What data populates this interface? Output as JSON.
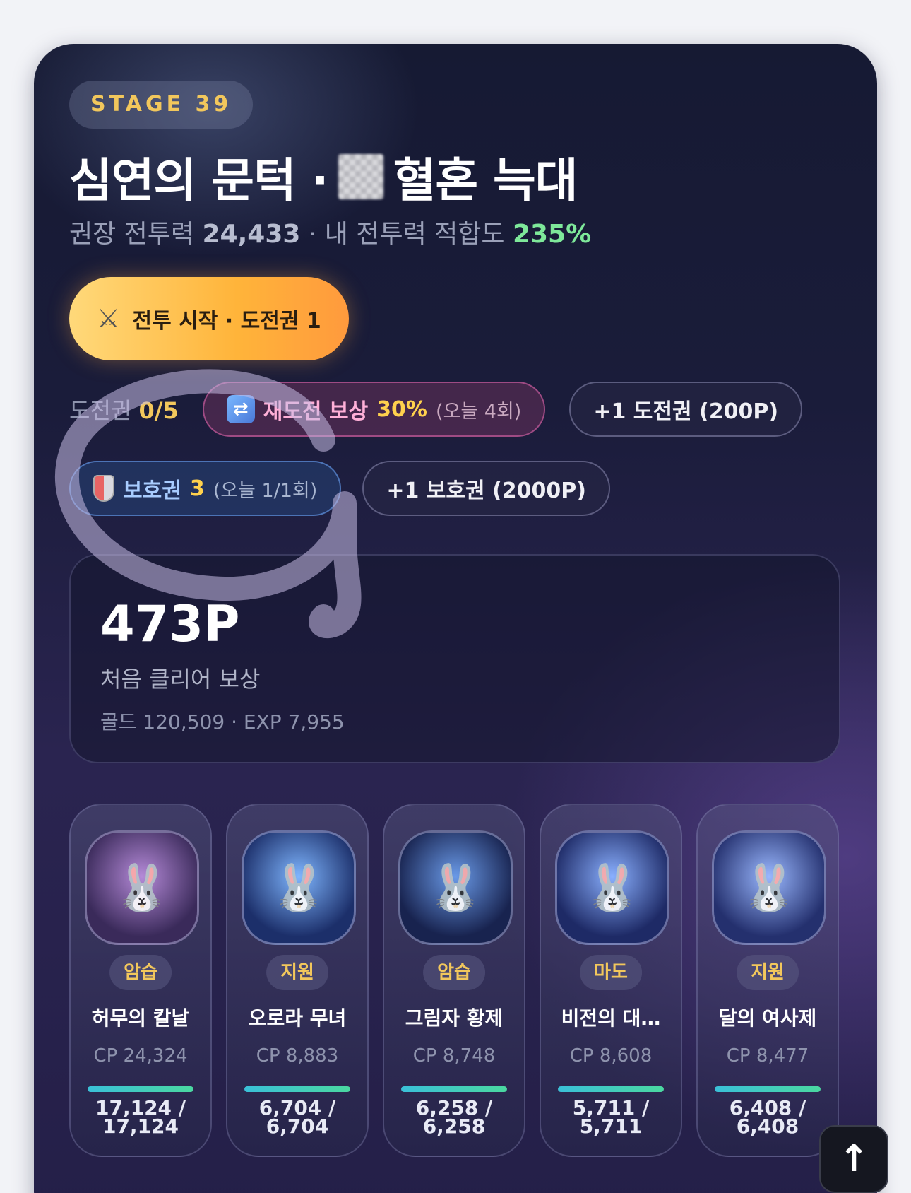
{
  "stage": {
    "label": "STAGE 39"
  },
  "title": {
    "prefix": "심연의 문턱 ·",
    "suffix": "혈혼 늑대"
  },
  "subtitle": {
    "recommended_label": "권장 전투력",
    "recommended_value": "24,433",
    "fit_label": "· 내 전투력 적합도",
    "fit_value": "235%"
  },
  "start_button": {
    "label": "전투 시작 · 도전권 1",
    "icon": "crossed-swords-icon"
  },
  "tickets": {
    "label": "도전권",
    "value": "0/5",
    "retry_reward_label": "재도전 보상",
    "retry_reward_pct": "30%",
    "retry_reward_today": "(오늘 4회)",
    "buy_ticket": "+1 도전권 (200P)"
  },
  "shields": {
    "label": "보호권",
    "value": "3",
    "today": "(오늘 1/1회)",
    "buy_shield": "+1 보호권 (2000P)"
  },
  "reward": {
    "amount": "473P",
    "label": "처음 클리어 보상",
    "detail": "골드 120,509 · EXP 7,955"
  },
  "heroes": [
    {
      "role": "암습",
      "name": "허무의 칼날",
      "cp": "CP 24,324",
      "hp_current": "17,124 /",
      "hp_max": "17,124",
      "hp_fraction": 1.0
    },
    {
      "role": "지원",
      "name": "오로라 무녀",
      "cp": "CP 8,883",
      "hp_current": "6,704 /",
      "hp_max": "6,704",
      "hp_fraction": 1.0
    },
    {
      "role": "암습",
      "name": "그림자 황제",
      "cp": "CP 8,748",
      "hp_current": "6,258 /",
      "hp_max": "6,258",
      "hp_fraction": 1.0
    },
    {
      "role": "마도",
      "name": "비전의 대…",
      "cp": "CP 8,608",
      "hp_current": "5,711 /",
      "hp_max": "5,711",
      "hp_fraction": 1.0
    },
    {
      "role": "지원",
      "name": "달의 여사제",
      "cp": "CP 8,477",
      "hp_current": "6,408 /",
      "hp_max": "6,408",
      "hp_fraction": 1.0
    }
  ],
  "scroll_top": {
    "icon": "arrow-up-icon",
    "glyph": "↑"
  },
  "colors": {
    "accent_gold": "#f2c75c",
    "fit_green": "#7ee89a",
    "button_orange": "#ffb43a"
  }
}
